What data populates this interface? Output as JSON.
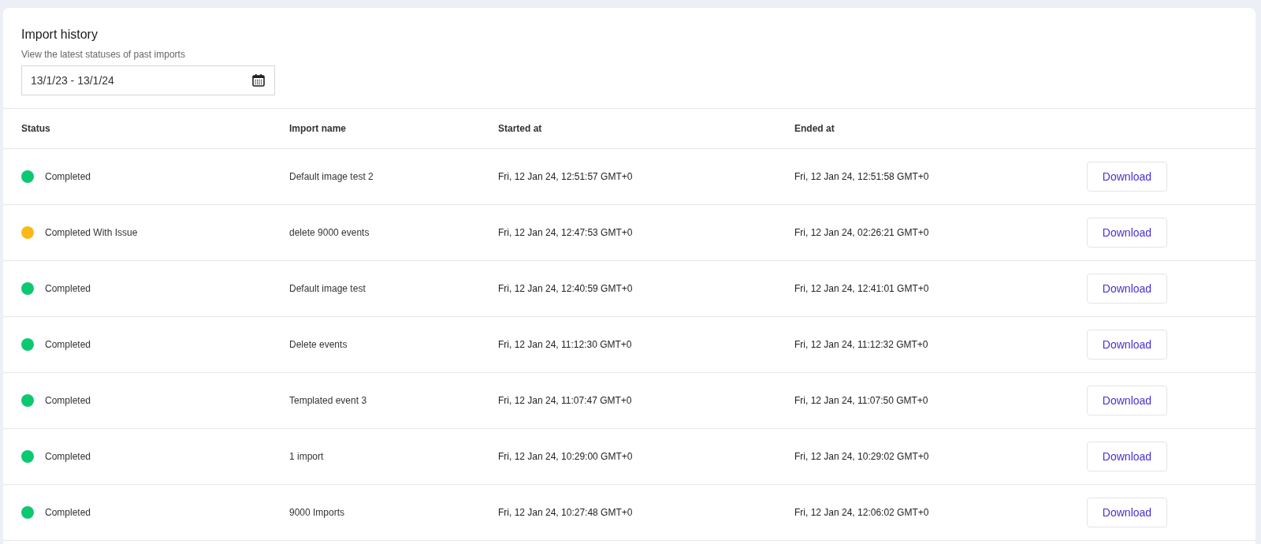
{
  "header": {
    "title": "Import history",
    "subtitle": "View the latest statuses of past imports",
    "date_range": "13/1/23 - 13/1/24"
  },
  "table": {
    "columns": [
      "Status",
      "Import name",
      "Started at",
      "Ended at"
    ],
    "rows": [
      {
        "status": "Completed",
        "color": "#0cc971",
        "name": "Default image test 2",
        "started": "Fri, 12 Jan 24, 12:51:57 GMT+0",
        "ended": "Fri, 12 Jan 24, 12:51:58 GMT+0",
        "action": "Download"
      },
      {
        "status": "Completed With Issue",
        "color": "#fbb917",
        "name": "delete 9000 events",
        "started": "Fri, 12 Jan 24, 12:47:53 GMT+0",
        "ended": "Fri, 12 Jan 24, 02:26:21 GMT+0",
        "action": "Download"
      },
      {
        "status": "Completed",
        "color": "#0cc971",
        "name": "Default image test",
        "started": "Fri, 12 Jan 24, 12:40:59 GMT+0",
        "ended": "Fri, 12 Jan 24, 12:41:01 GMT+0",
        "action": "Download"
      },
      {
        "status": "Completed",
        "color": "#0cc971",
        "name": "Delete events",
        "started": "Fri, 12 Jan 24, 11:12:30 GMT+0",
        "ended": "Fri, 12 Jan 24, 11:12:32 GMT+0",
        "action": "Download"
      },
      {
        "status": "Completed",
        "color": "#0cc971",
        "name": "Templated event 3",
        "started": "Fri, 12 Jan 24, 11:07:47 GMT+0",
        "ended": "Fri, 12 Jan 24, 11:07:50 GMT+0",
        "action": "Download"
      },
      {
        "status": "Completed",
        "color": "#0cc971",
        "name": "1 import",
        "started": "Fri, 12 Jan 24, 10:29:00 GMT+0",
        "ended": "Fri, 12 Jan 24, 10:29:02 GMT+0",
        "action": "Download"
      },
      {
        "status": "Completed",
        "color": "#0cc971",
        "name": "9000 Imports",
        "started": "Fri, 12 Jan 24, 10:27:48 GMT+0",
        "ended": "Fri, 12 Jan 24, 12:06:02 GMT+0",
        "action": "Download"
      }
    ]
  }
}
